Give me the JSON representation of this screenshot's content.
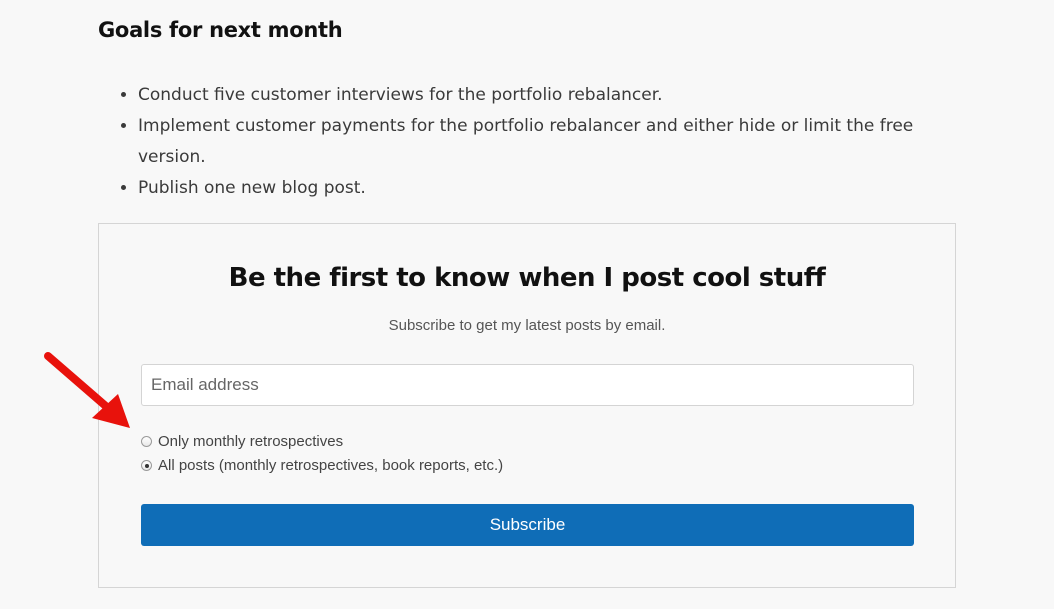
{
  "goals": {
    "heading": "Goals for next month",
    "items": [
      "Conduct five customer interviews for the portfolio rebalancer.",
      "Implement customer payments for the portfolio rebalancer and either hide or limit the free version.",
      "Publish one new blog post."
    ]
  },
  "subscribe": {
    "title": "Be the first to know when I post cool stuff",
    "subtitle": "Subscribe to get my latest posts by email.",
    "email_placeholder": "Email address",
    "options": [
      {
        "label": "Only monthly retrospectives",
        "checked": false
      },
      {
        "label": "All posts (monthly retrospectives, book reports, etc.)",
        "checked": true
      }
    ],
    "button_label": "Subscribe"
  },
  "colors": {
    "button": "#0f6db7",
    "annotation_arrow": "#e8120c"
  }
}
